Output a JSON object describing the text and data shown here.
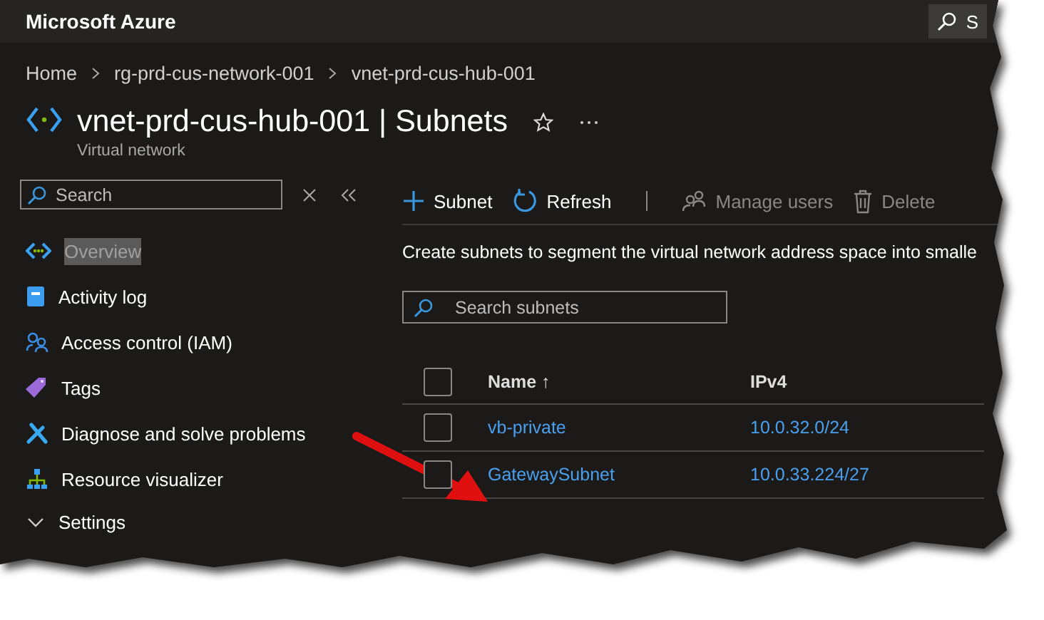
{
  "app": {
    "title": "Microsoft Azure",
    "search_label": "S"
  },
  "breadcrumb": [
    "Home",
    "rg-prd-cus-network-001",
    "vnet-prd-cus-hub-001"
  ],
  "header": {
    "title": "vnet-prd-cus-hub-001 | Subnets",
    "subtitle": "Virtual network"
  },
  "sidebar": {
    "search": {
      "placeholder": "Search"
    },
    "items": [
      {
        "label": "Overview",
        "kind": "item",
        "selected": true
      },
      {
        "label": "Activity log",
        "kind": "item",
        "selected": false
      },
      {
        "label": "Access control (IAM)",
        "kind": "item",
        "selected": false
      },
      {
        "label": "Tags",
        "kind": "item",
        "selected": false
      },
      {
        "label": "Diagnose and solve problems",
        "kind": "item",
        "selected": false
      },
      {
        "label": "Resource visualizer",
        "kind": "item",
        "selected": false
      },
      {
        "label": "Settings",
        "kind": "group",
        "selected": false,
        "expanded": true
      }
    ]
  },
  "toolbar": [
    {
      "label": "Subnet",
      "disabled": false
    },
    {
      "label": "Refresh",
      "disabled": false
    },
    {
      "label": "Manage users",
      "disabled": true
    },
    {
      "label": "Delete",
      "disabled": true
    }
  ],
  "description": "Create subnets to segment the virtual network address space into smalle",
  "table_search": {
    "placeholder": "Search subnets"
  },
  "table": {
    "all_selected": false,
    "columns": [
      "Name ↑",
      "IPv4"
    ],
    "rows": [
      {
        "name": "vb-private",
        "ipv4": "10.0.32.0/24",
        "selected": false
      },
      {
        "name": "GatewaySubnet",
        "ipv4": "10.0.33.224/27",
        "selected": false
      }
    ]
  },
  "annotations": [
    {
      "kind": "arrow"
    }
  ]
}
